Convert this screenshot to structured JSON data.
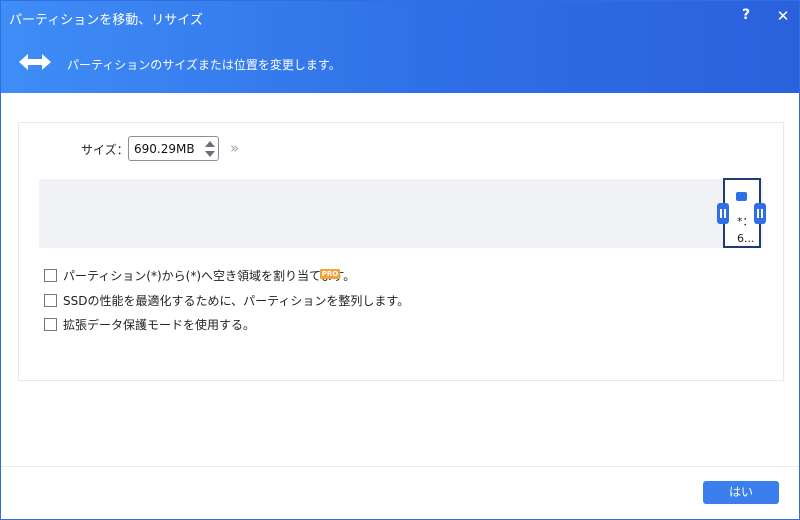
{
  "window": {
    "title": "パーティションを移動、リサイズ",
    "help_label": "?",
    "close_label": "✕"
  },
  "header": {
    "subtitle": "パーティションのサイズまたは位置を変更します。",
    "icon": "move-arrows-icon"
  },
  "size": {
    "label": "サイズ：",
    "value": "690.29MB",
    "expand_label": "»"
  },
  "partition": {
    "star": "*：",
    "size_abbr": "6..."
  },
  "options": [
    {
      "label": "パーティション(*)から(*)へ空き領域を割り当てます。",
      "checked": false,
      "badge": "PRO"
    },
    {
      "label": "SSDの性能を最適化するために、パーティションを整列します。",
      "checked": false
    },
    {
      "label": "拡張データ保護モードを使用する。",
      "checked": false
    }
  ],
  "footer": {
    "ok_label": "はい"
  },
  "colors": {
    "accent": "#2f6fe6",
    "pro_badge": "#f4a23c",
    "disk_bar": "#f0f2f6"
  }
}
